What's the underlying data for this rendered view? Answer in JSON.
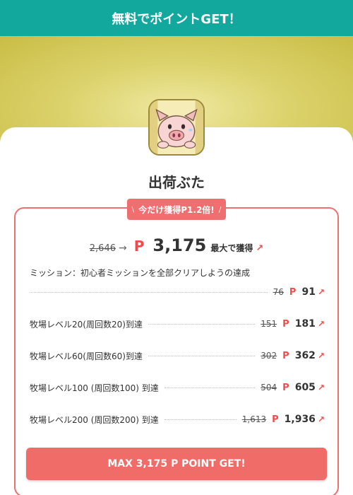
{
  "header": {
    "title": "無料でポイントGET！"
  },
  "app": {
    "icon": "pig-app-icon",
    "name": "出荷ぶた"
  },
  "promo": {
    "slash_left": "\\",
    "text": "今だけ獲得P1.2倍!",
    "slash_right": "/"
  },
  "total": {
    "old": "2,646",
    "arrow": "→",
    "p": "P",
    "value": "3,175",
    "label": "最大で獲得",
    "up_icon": "↗"
  },
  "mission": {
    "text": "ミッション：初心者ミッションを全部クリアしようの達成"
  },
  "rows": [
    {
      "label": "",
      "old": "76",
      "p": "P",
      "value": "91",
      "up": "↗"
    },
    {
      "label": "牧場レベル20(周回数20)到達",
      "old": "151",
      "p": "P",
      "value": "181",
      "up": "↗"
    },
    {
      "label": "牧場レベル60(周回数60)到達",
      "old": "302",
      "p": "P",
      "value": "362",
      "up": "↗"
    },
    {
      "label": "牧場レベル100 (周回数100) 到達",
      "old": "504",
      "p": "P",
      "value": "605",
      "up": "↗"
    },
    {
      "label": "牧場レベル200 (周回数200) 到達",
      "old": "1,613",
      "p": "P",
      "value": "1,936",
      "up": "↗"
    }
  ],
  "cta": {
    "label": "MAX 3,175 P POINT GET!"
  },
  "colors": {
    "header": "#13a89e",
    "accent": "#ef6f70",
    "point": "#ef4d4d"
  }
}
